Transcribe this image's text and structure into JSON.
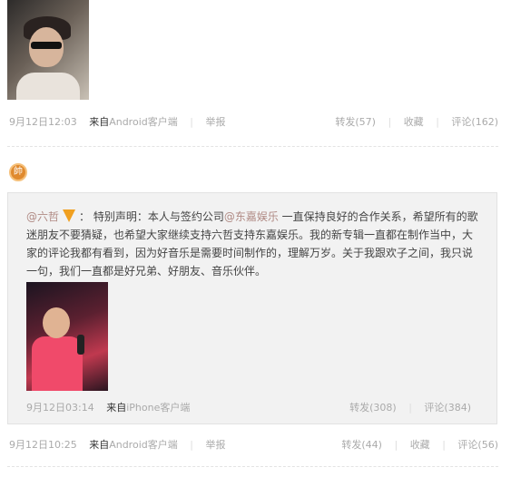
{
  "post1": {
    "time": "9月12日12:03",
    "from_label": "来自",
    "client": "Android客户端",
    "report": "举报",
    "repost": "转发(57)",
    "favorite": "收藏",
    "comment": "评论(162)"
  },
  "post2": {
    "avatar_glyph": "帥",
    "author": "@六哲",
    "text_a": "：  特别声明：本人与签约公司",
    "mention": "@东嘉娱乐",
    "text_b": " 一直保持良好的合作关系，希望所有的歌迷朋友不要猜疑，也希望大家继续支持六哲支持东嘉娱乐。我的新专辑一直都在制作当中，大家的评论我都有看到，因为好音乐是需要时间制作的，理解万岁。关于我跟欢子之间，我只说一句，我们一直都是好兄弟、好朋友、音乐伙伴。",
    "orig_time": "9月12日03:14",
    "orig_from_label": "来自",
    "orig_client": "iPhone客户端",
    "orig_repost": "转发(308)",
    "orig_comment": "评论(384)",
    "time": "9月12日10:25",
    "from_label": "来自",
    "client": "Android客户端",
    "report": "举报",
    "repost": "转发(44)",
    "favorite": "收藏",
    "comment": "评论(56)"
  },
  "colors": {
    "link": "#b08a84",
    "muted": "#aaaaaa",
    "box_bg": "#f2f2f2",
    "verified": "#f0a020"
  }
}
